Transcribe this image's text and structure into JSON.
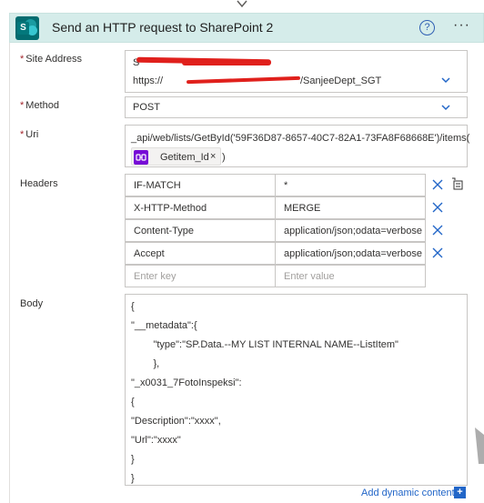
{
  "header": {
    "title": "Send an HTTP request to SharePoint 2",
    "help_glyph": "?",
    "more_glyph": "···",
    "logo_letter": "S"
  },
  "site_address": {
    "label": "Site Address",
    "required_mark": "*",
    "line1_value": "S",
    "line2_value_start": "https://",
    "line2_value_end": "/SanjeeDept_SGT"
  },
  "method": {
    "label": "Method",
    "required_mark": "*",
    "value": "POST"
  },
  "uri": {
    "label": "Uri",
    "required_mark": "*",
    "value_prefix": "_api/web/lists/GetById('59F36D87-8657-40C7-82A1-73FA8F68668E')/items(",
    "token_label": "Getitem_Id",
    "token_remove": "×",
    "value_suffix": ")"
  },
  "headers": {
    "label": "Headers",
    "rows": [
      {
        "key": "IF-MATCH",
        "value": "*"
      },
      {
        "key": "X-HTTP-Method",
        "value": "MERGE"
      },
      {
        "key": "Content-Type",
        "value": "application/json;odata=verbose"
      },
      {
        "key": "Accept",
        "value": "application/json;odata=verbose"
      }
    ],
    "key_placeholder": "Enter key",
    "value_placeholder": "Enter value"
  },
  "body": {
    "label": "Body",
    "lines": [
      "{",
      "\"__metadata\":{",
      "        \"type\":\"SP.Data.--MY LIST INTERNAL NAME--ListItem\"",
      "        },",
      "\"_x0031_7FotoInspeksi\":",
      "{",
      "\"Description\":\"xxxx\",",
      "\"Url\":\"xxxx\"",
      "}",
      "}"
    ]
  },
  "dynamic_content": {
    "label": "Add dynamic content",
    "plus_glyph": "+"
  },
  "colors": {
    "header_bg": "#d5ecea",
    "sharepoint_brand": "#036c70",
    "link_blue": "#2266c8",
    "required_red": "#a4262c",
    "token_purple": "#770bd6"
  }
}
